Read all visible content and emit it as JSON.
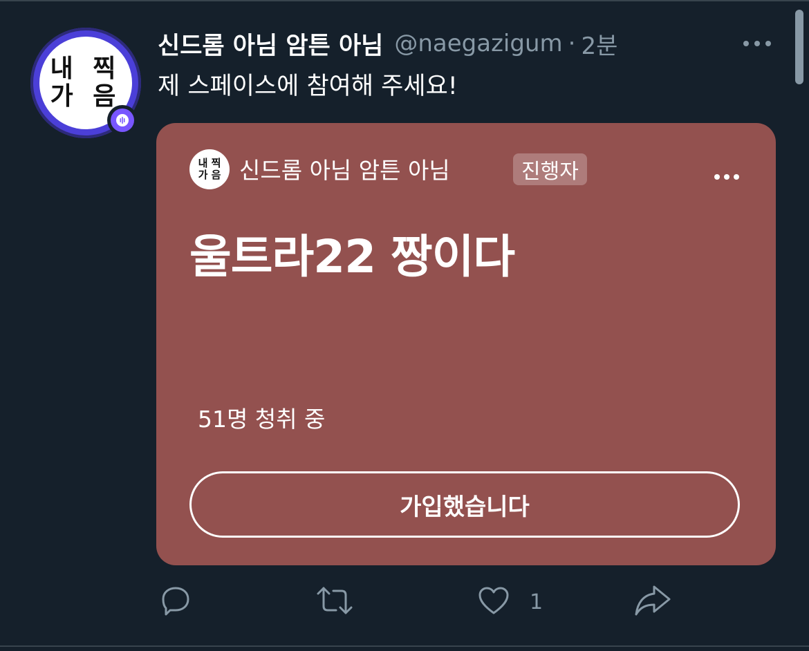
{
  "tweet": {
    "display_name": "신드롬 아님 암튼 아님",
    "handle": "@naegazigum",
    "separator": "·",
    "time": "2분",
    "text": "제 스페이스에 참여해 주세요!",
    "avatar_text": [
      "내 찍",
      "가 음"
    ]
  },
  "space_card": {
    "host_name": "신드롬 아님 암튼 아님",
    "host_badge": "진행자",
    "host_avatar_text": [
      "내 찍",
      "가 음"
    ],
    "title": "울트라22 짱이다",
    "listeners": "51명 청취 중",
    "join_button_label": "가입했습니다",
    "background_color": "#93514f"
  },
  "actions": {
    "reply_icon": "reply-icon",
    "retweet_icon": "retweet-icon",
    "like_icon": "heart-icon",
    "like_count": "1",
    "share_icon": "share-icon"
  },
  "colors": {
    "background": "#15202b",
    "secondary_text": "#8899a6",
    "space_purple": "#7856ff"
  }
}
